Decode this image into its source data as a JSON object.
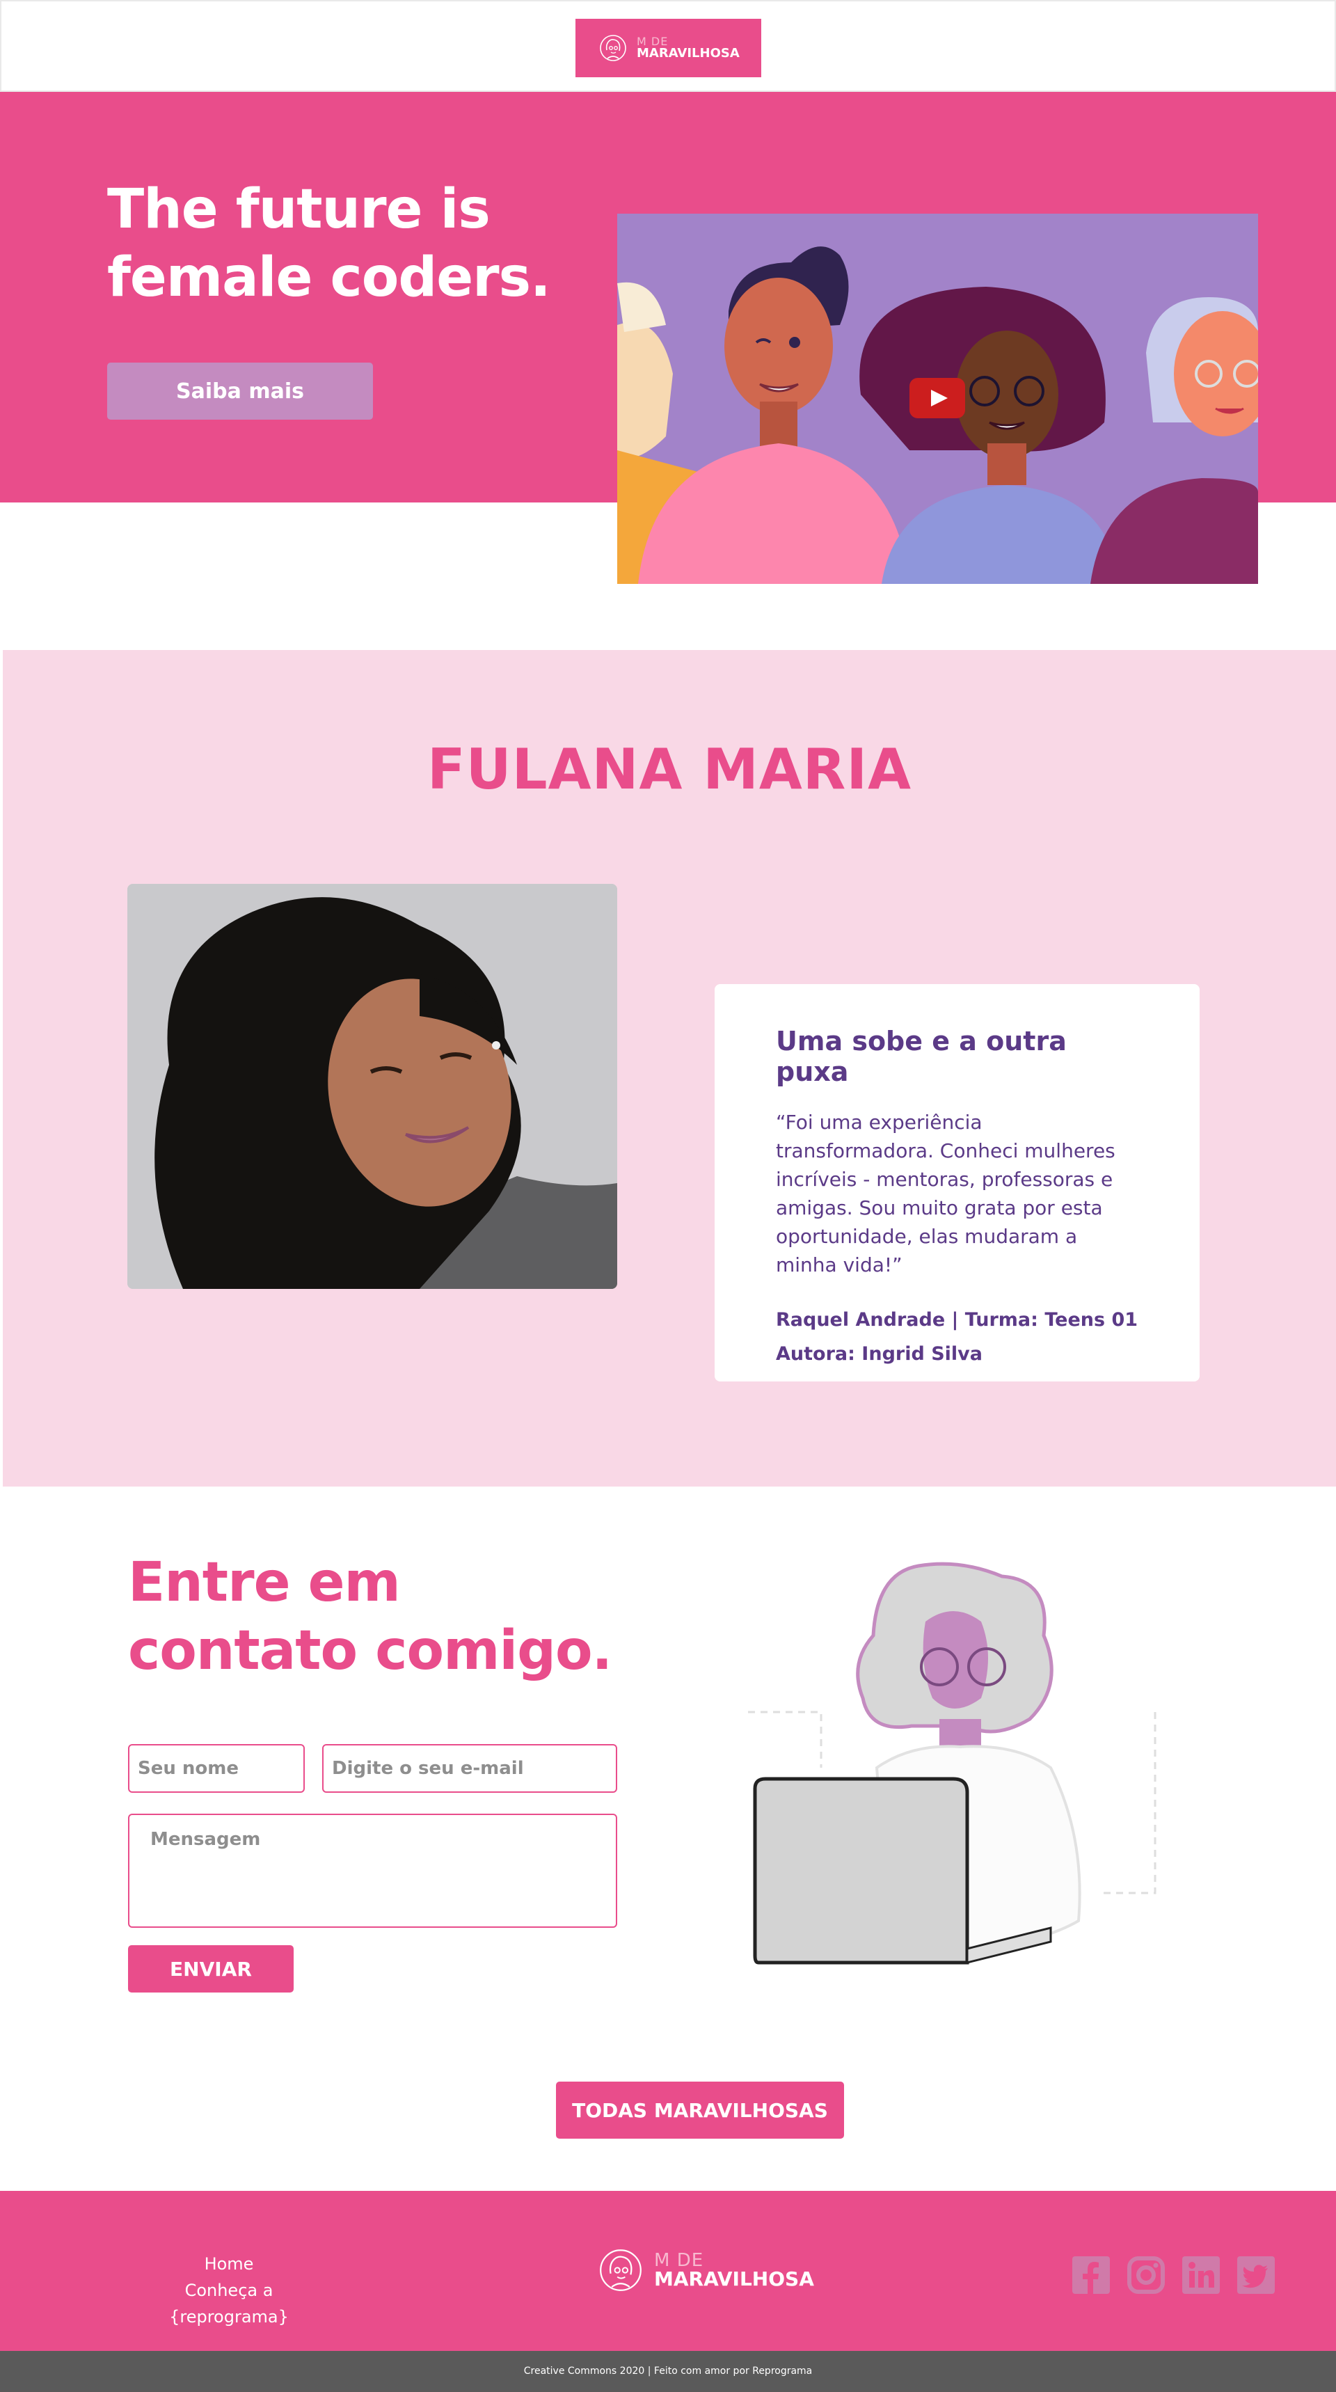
{
  "header": {
    "logo": {
      "small": "M DE",
      "big": "MARAVILHOSA",
      "icon": "woman-face-icon"
    }
  },
  "hero": {
    "title_line1": "The future is",
    "title_line2": "female coders.",
    "button": "Saiba mais",
    "video": {
      "icon": "play-icon"
    }
  },
  "profile": {
    "name": "FULANA MARIA",
    "card": {
      "title": "Uma sobe e a outra puxa",
      "quote": "“Foi uma experiência transformadora. Conheci mulheres incríveis - mentoras, professoras e amigas. Sou muito grata por esta oportunidade, elas mudaram a minha vida!”",
      "author_line": "Raquel Andrade | Turma: Teens 01",
      "by_line": "Autora: Ingrid Silva"
    }
  },
  "contact": {
    "title_line1": "Entre em",
    "title_line2": "contato comigo.",
    "name_placeholder": "Seu nome",
    "email_placeholder": "Digite o seu e-mail",
    "message_placeholder": "Mensagem",
    "send": "ENVIAR"
  },
  "all_button": "TODAS MARAVILHOSAS",
  "footer": {
    "links": [
      "Home",
      "Conheça a {reprograma}"
    ],
    "logo": {
      "small": "M DE",
      "big": "MARAVILHOSA"
    },
    "socials": [
      "facebook-icon",
      "instagram-icon",
      "linkedin-icon",
      "twitter-icon"
    ],
    "copyright": "Creative Commons 2020 | Feito com amor por Reprograma"
  },
  "colors": {
    "brand": "#e94d8b",
    "light_pink": "#f9d8e6",
    "purple": "#5b3a87",
    "lilac": "#c48bc0"
  }
}
